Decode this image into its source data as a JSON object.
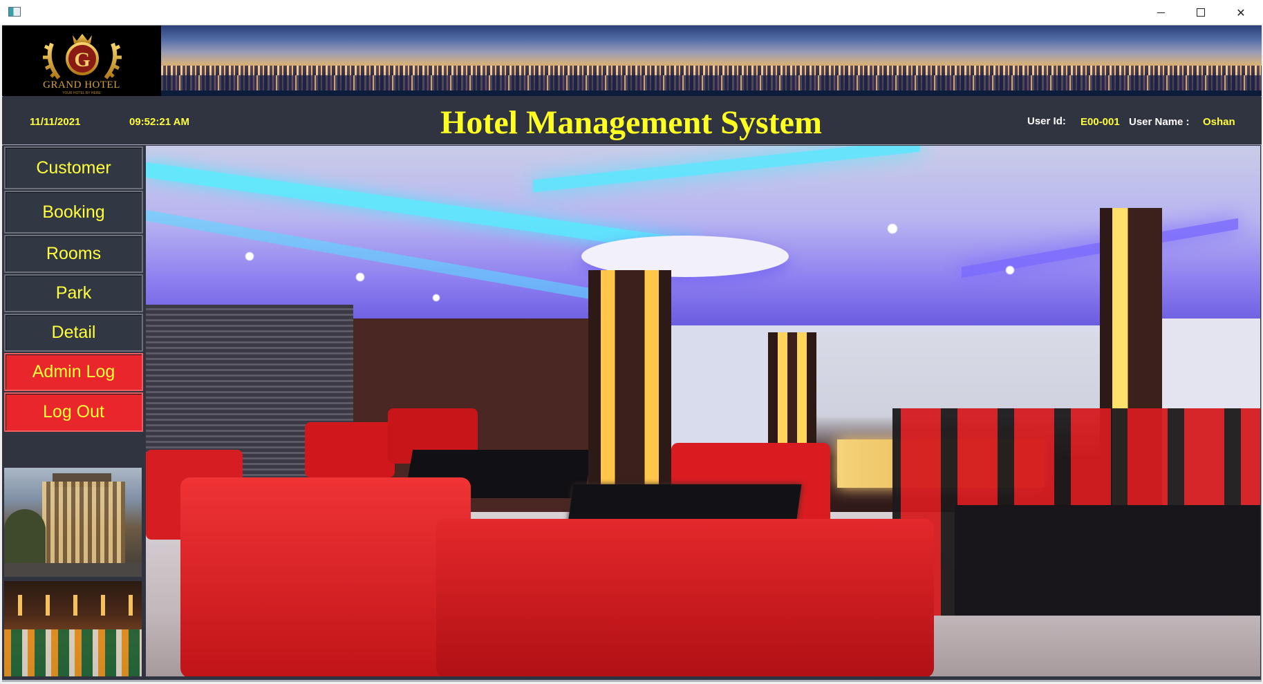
{
  "window": {
    "title": "",
    "controls": {
      "minimize_icon": "minimize-icon",
      "maximize_icon": "maximize-icon",
      "close_glyph": "✕"
    }
  },
  "logo": {
    "name": "GRAND HOTEL",
    "tagline": "YOUR HOTEL BY HERE",
    "letter": "G"
  },
  "header": {
    "date": "11/11/2021",
    "time": "09:52:21 AM",
    "title": "Hotel Management System",
    "user_id_label": "User Id:",
    "user_id": "E00-001",
    "user_name_label": "User Name :",
    "user_name": "Oshan"
  },
  "sidebar": {
    "items": [
      {
        "label": "Customer"
      },
      {
        "label": "Booking"
      },
      {
        "label": "Rooms"
      },
      {
        "label": "Park"
      },
      {
        "label": "Detail"
      },
      {
        "label": "Admin Log"
      },
      {
        "label": "Log Out"
      }
    ]
  },
  "colors": {
    "panel_bg": "#2f3440",
    "accent_text": "#ffff3c",
    "danger_button": "#e8262b"
  }
}
